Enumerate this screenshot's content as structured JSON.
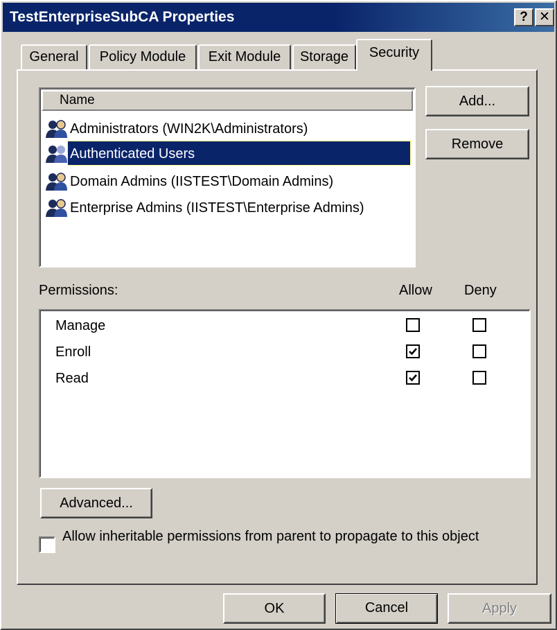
{
  "window": {
    "title": "TestEnterpriseSubCA Properties",
    "help_glyph": "?",
    "close_glyph": "✕"
  },
  "tabs": [
    {
      "label": "General"
    },
    {
      "label": "Policy Module"
    },
    {
      "label": "Exit Module"
    },
    {
      "label": "Storage"
    },
    {
      "label": "Security",
      "active": true
    }
  ],
  "names": {
    "header": "Name",
    "selected_index": 1,
    "items": [
      {
        "label": "Administrators (WIN2K\\Administrators)",
        "icon": "group-icon"
      },
      {
        "label": "Authenticated Users",
        "icon": "group-icon"
      },
      {
        "label": "Domain Admins (IISTEST\\Domain Admins)",
        "icon": "group-icon"
      },
      {
        "label": "Enterprise Admins (IISTEST\\Enterprise Admins)",
        "icon": "group-icon"
      }
    ]
  },
  "buttons": {
    "add": "Add...",
    "remove": "Remove",
    "advanced": "Advanced...",
    "ok": "OK",
    "cancel": "Cancel",
    "apply": "Apply"
  },
  "permissions": {
    "label": "Permissions:",
    "allow_header": "Allow",
    "deny_header": "Deny",
    "items": [
      {
        "name": "Manage",
        "allow": false,
        "deny": false
      },
      {
        "name": "Enroll",
        "allow": true,
        "deny": false
      },
      {
        "name": "Read",
        "allow": true,
        "deny": false
      }
    ]
  },
  "inherit": {
    "label": "Allow inheritable permissions from parent to propagate to this object",
    "checked": false
  },
  "colors": {
    "titlebar": "#0a246a",
    "face": "#d4d0c8",
    "selection": "#0a246a"
  }
}
